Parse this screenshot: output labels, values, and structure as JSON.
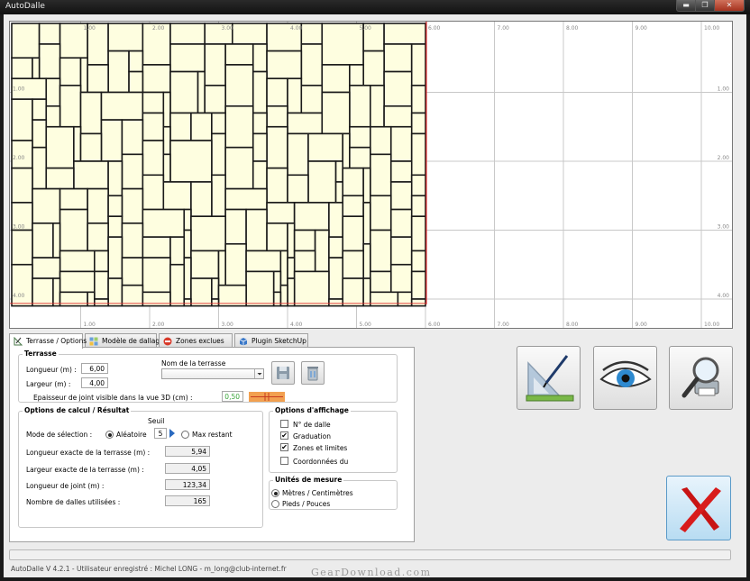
{
  "window": {
    "title": "AutoDalle",
    "minimize": "▬",
    "maximize": "❐",
    "close": "✕"
  },
  "plan": {
    "x_ticks_top": [
      "1.00",
      "2.00",
      "3.00",
      "4.00",
      "5.00",
      "6.00",
      "7.00",
      "8.00",
      "9.00",
      "10.00"
    ],
    "x_ticks_bottom": [
      "1.00",
      "2.00",
      "3.00",
      "4.00",
      "5.00",
      "6.00",
      "7.00",
      "8.00",
      "9.00",
      "10.00"
    ],
    "y_ticks_left": [
      "1.00",
      "2.00",
      "3.00",
      "4.00"
    ],
    "y_ticks_right": [
      "1.00",
      "2.00",
      "3.00",
      "4.00"
    ],
    "tile_color": "#fefee0",
    "joint_color": "#1a1a1a",
    "limit_color": "#e03030",
    "grid_color": "#c8c8c8"
  },
  "tabs": [
    {
      "label": "Terrasse / Options",
      "icon": "set-square-icon"
    },
    {
      "label": "Modèle de dallage",
      "icon": "tile-pattern-icon"
    },
    {
      "label": "Zones exclues",
      "icon": "forbidden-icon"
    },
    {
      "label": "Plugin SketchUp",
      "icon": "sketchup-icon"
    }
  ],
  "terrasse": {
    "title": "Terrasse",
    "longueur_label": "Longueur (m) :",
    "longueur_value": "6,00",
    "largeur_label": "Largeur (m) :",
    "largeur_value": "4,00",
    "nom_label": "Nom de la terrasse",
    "nom_value": "",
    "epaisseur_label": "Epaisseur de joint visible dans la vue 3D (cm) :",
    "epaisseur_value": "0,50"
  },
  "calcul": {
    "title": "Options de calcul / Résultat",
    "seuil_label": "Seuil",
    "mode_label": "Mode de sélection :",
    "aleatoire_label": "Aléatoire",
    "seuil_value": "5",
    "max_restant_label": "Max restant",
    "longueur_exacte_label": "Longueur exacte de la terrasse (m) :",
    "longueur_exacte_value": "5,94",
    "largeur_exacte_label": "Largeur exacte de la terrasse (m) :",
    "largeur_exacte_value": "4,05",
    "longueur_joint_label": "Longueur de joint (m) :",
    "longueur_joint_value": "123,34",
    "nombre_dalles_label": "Nombre de dalles utilisées :",
    "nombre_dalles_value": "165"
  },
  "affichage": {
    "title": "Options d'affichage",
    "items": [
      {
        "label": "N° de dalle",
        "checked": false
      },
      {
        "label": "Graduation",
        "checked": true
      },
      {
        "label": "Zones et limites",
        "checked": true
      },
      {
        "label": "Coordonnées du",
        "checked": false
      }
    ],
    "check_mark": "✔"
  },
  "unites": {
    "title": "Unités de mesure",
    "metres_label": "Mètres / Centimètres",
    "pieds_label": "Pieds / Pouces",
    "selected": "metres"
  },
  "status": {
    "text": "AutoDalle  V 4.2.1 - Utilisateur enregistré : Michel LONG - m_long@club-internet.fr",
    "watermark": "GearDownload.com"
  }
}
